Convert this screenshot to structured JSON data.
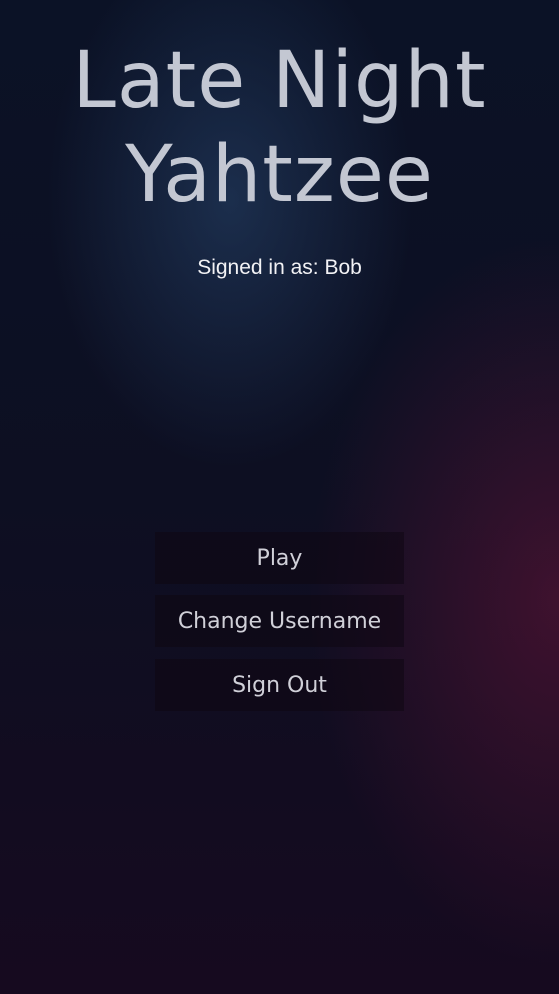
{
  "title": {
    "line1": "Late Night",
    "line2": "Yahtzee"
  },
  "signed_in": "Signed in as: Bob",
  "buttons": {
    "play": "Play",
    "change_username": "Change Username",
    "sign_out": "Sign Out"
  }
}
